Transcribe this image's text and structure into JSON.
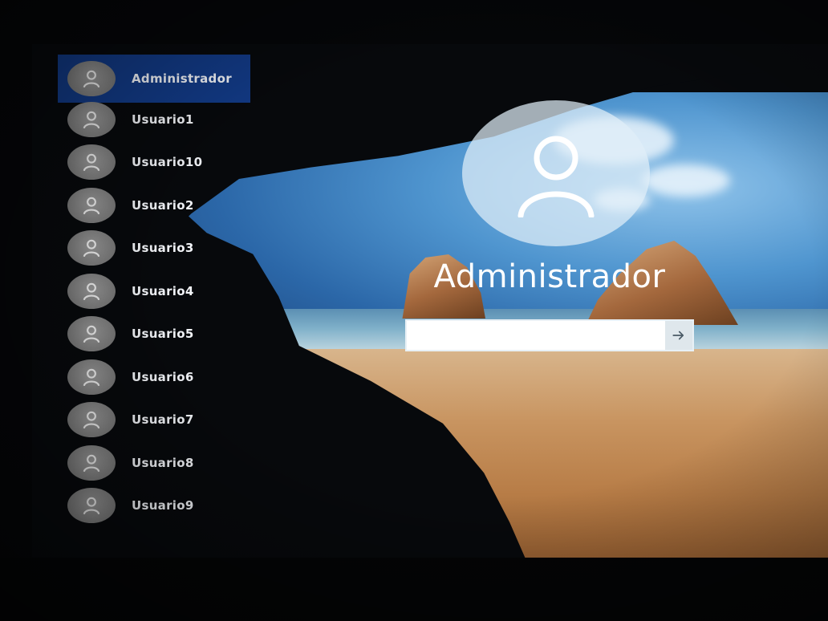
{
  "users": [
    {
      "label": "Administrador",
      "selected": true
    },
    {
      "label": "Usuario1",
      "selected": false
    },
    {
      "label": "Usuario10",
      "selected": false
    },
    {
      "label": "Usuario2",
      "selected": false
    },
    {
      "label": "Usuario3",
      "selected": false
    },
    {
      "label": "Usuario4",
      "selected": false
    },
    {
      "label": "Usuario5",
      "selected": false
    },
    {
      "label": "Usuario6",
      "selected": false
    },
    {
      "label": "Usuario7",
      "selected": false
    },
    {
      "label": "Usuario8",
      "selected": false
    },
    {
      "label": "Usuario9",
      "selected": false
    }
  ],
  "account": {
    "name": "Administrador",
    "password_value": "",
    "avatar_icon": "user-avatar-icon",
    "submit_icon": "arrow-right-icon"
  },
  "colors": {
    "selected_highlight": "#123a86",
    "avatar_gray": "#7b7b7b",
    "text": "#f2f4f8"
  }
}
